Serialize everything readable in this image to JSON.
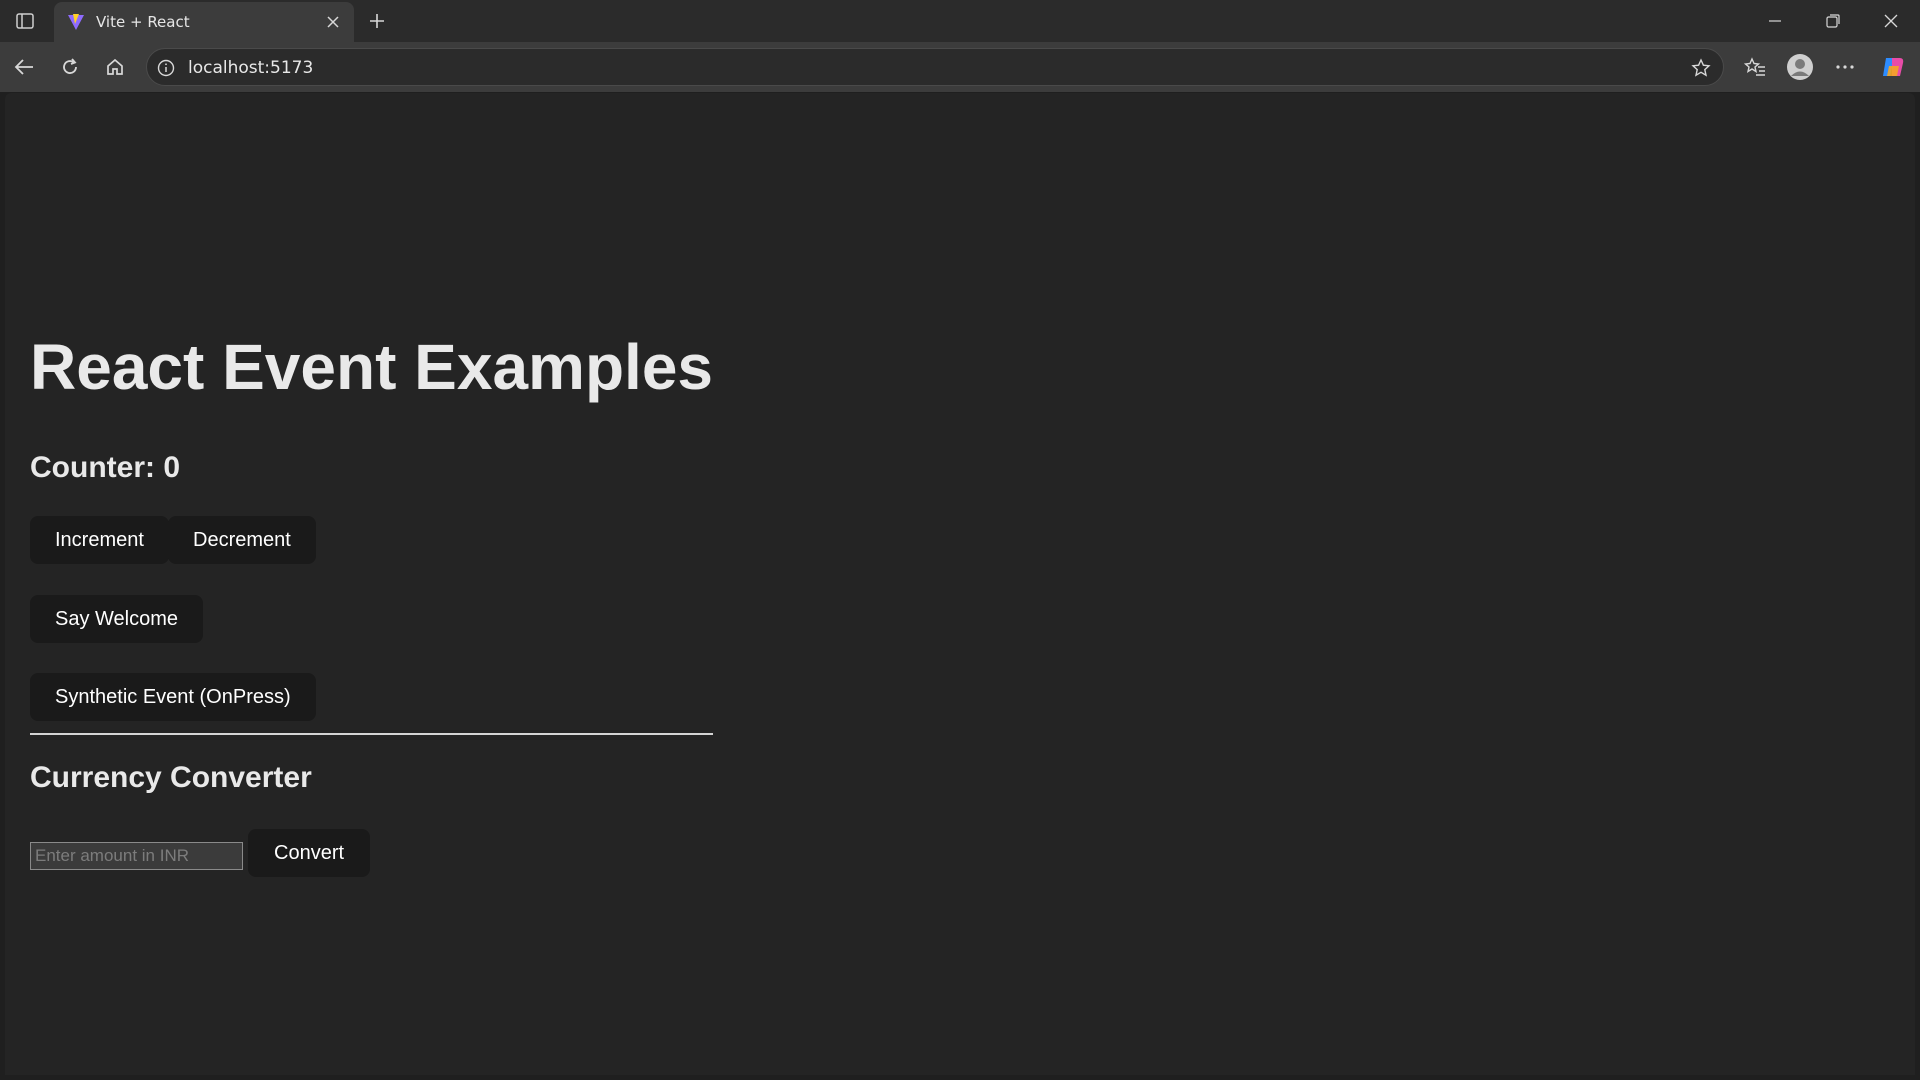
{
  "browser": {
    "tab": {
      "title": "Vite + React"
    },
    "address": {
      "url": "localhost:5173"
    }
  },
  "page": {
    "title": "React Event Examples",
    "counter": {
      "label": "Counter: 0"
    },
    "buttons": {
      "increment": "Increment",
      "decrement": "Decrement",
      "welcome": "Say Welcome",
      "synthetic": "Synthetic Event (OnPress)"
    },
    "converter": {
      "title": "Currency Converter",
      "input_placeholder": "Enter amount in INR",
      "input_value": "",
      "convert_label": "Convert"
    }
  },
  "icons": {
    "sidebar": "sidebar-toggle-icon",
    "favicon": "vite-logo-icon",
    "close_tab": "close-icon",
    "new_tab": "plus-icon",
    "minimize": "minimize-icon",
    "restore": "restore-icon",
    "close_window": "close-icon",
    "back": "back-arrow-icon",
    "reload": "reload-icon",
    "home": "home-icon",
    "site_info": "info-icon",
    "favorite": "star-icon",
    "favorites": "favorites-icon",
    "profile": "profile-icon",
    "menu": "more-icon",
    "copilot": "copilot-icon"
  },
  "colors": {
    "page_bg": "#242424",
    "button_bg": "#1a1a1a",
    "text": "#e9e9e9"
  }
}
